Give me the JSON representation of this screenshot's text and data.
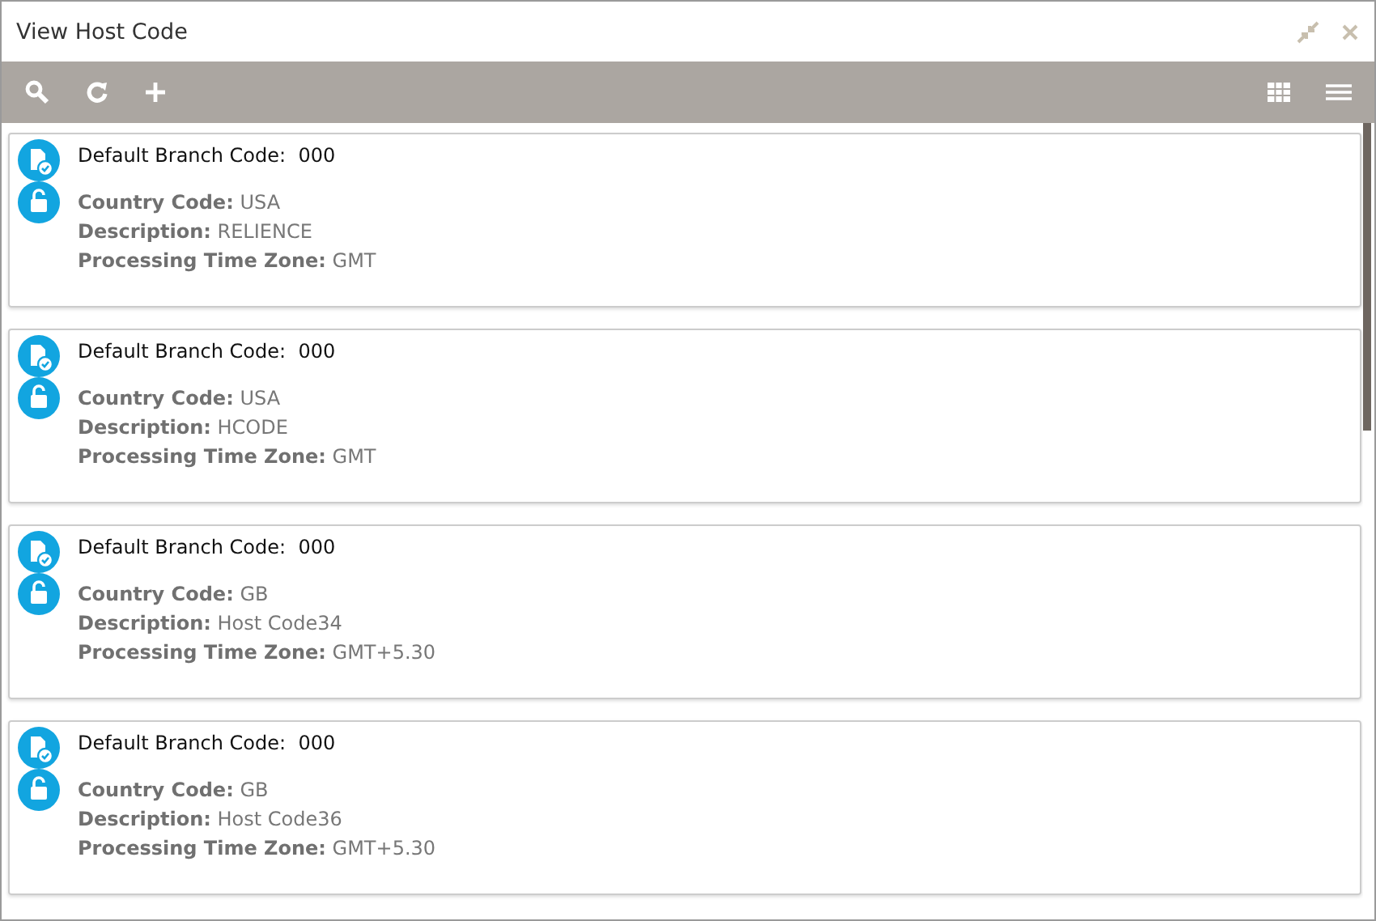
{
  "window": {
    "title": "View Host Code"
  },
  "records": [
    {
      "header": "Default Branch Code:  000",
      "fields": [
        "**Country Code:** USA",
        "**Description:** RELIENCE",
        "**Processing Time Zone:** GMT"
      ]
    },
    {
      "header": "Default Branch Code:  000",
      "fields": [
        "**Country Code:** USA",
        "**Description:** HCODE",
        "**Processing Time Zone:** GMT"
      ]
    },
    {
      "header": "Default Branch Code:  000",
      "fields": [
        "**Country Code:** GB",
        "**Description:** Host Code34",
        "**Processing Time Zone:** GMT+5.30"
      ]
    },
    {
      "header": "Default Branch Code:  000",
      "fields": [
        "**Country Code:** GB",
        "**Description:** Host Code36",
        "**Processing Time Zone:** GMT+5.30"
      ]
    }
  ]
}
